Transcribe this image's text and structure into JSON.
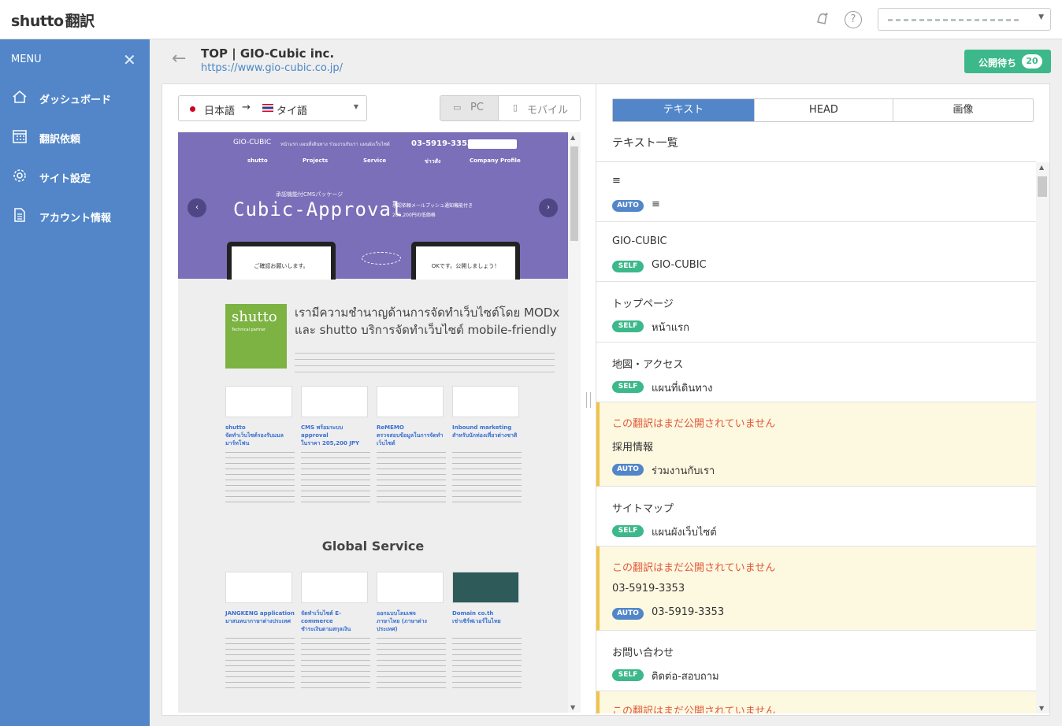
{
  "app": {
    "logo": "shutto",
    "logo_ja": "翻訳",
    "icons": {
      "bell": "notification-bell-icon",
      "help": "?"
    },
    "account_placeholder": ""
  },
  "sidebar": {
    "menu_label": "MENU",
    "close_glyph": "✕",
    "items": [
      {
        "label": "ダッシュボード",
        "icon": "home-icon",
        "glyph": "⌂"
      },
      {
        "label": "翻訳依頼",
        "icon": "calendar-icon",
        "glyph": "▦"
      },
      {
        "label": "サイト設定",
        "icon": "gear-icon",
        "glyph": "⚙"
      },
      {
        "label": "アカウント情報",
        "icon": "document-icon",
        "glyph": "▤"
      }
    ]
  },
  "page": {
    "back_glyph": "←",
    "title": "TOP | GIO-Cubic inc.",
    "url": "https://www.gio-cubic.co.jp/",
    "publish_label": "公開待ち",
    "publish_count": "20"
  },
  "preview": {
    "lang_source": "日本語",
    "lang_arrow": "→",
    "lang_target": "タイ語",
    "device_pc": "PC",
    "device_mobile": "モバイル",
    "site": {
      "brand": "GIO-CUBIC",
      "nav": "หน้าแรก   แผนที่เดินทาง   ร่วมงานกับเรา   แผนผังเว็บไซต์",
      "tel": "03-5919-3353",
      "subnav": [
        "shutto",
        "Projects",
        "Service",
        "ข่าวสัง",
        "Company Profile"
      ],
      "tagline": "承認機能付CMSパッケージ",
      "hero_title": "Cubic-Approval",
      "hero_side": "承認依頼メールプッシュ通知機能付き\n205,200円の低価格",
      "screen_left": "ご確認お願いします。",
      "screen_right": "OKです。公開しましょう！",
      "logo_word": "shutto",
      "logo_sub": "Technical partner",
      "heading": "เรามีความชำนาญด้านการจัดทำเว็บไซต์โดย MODx และ shutto บริการจัดทำเว็บไซต์ mobile-friendly",
      "cards": [
        {
          "title": "shutto\nจัดทำเว็บไซต์รองรับมมล มาร์ทโฟน"
        },
        {
          "title": "CMS พร้อมระบบ approval\nในราคา 205,200 JPY"
        },
        {
          "title": "ReMEMO\nตรวจสอบข้อมูลในการจัดทำเว็บไซต์"
        },
        {
          "title": "Inbound marketing\nสำหรับนักท่องเที่ยวต่างชาติ"
        }
      ],
      "global_service": "Global Service",
      "cards2": [
        {
          "title": "JANGKENG application\nมาสนหนากาษาต่างประเทศ"
        },
        {
          "title": "จัดทำเว็บไซต์ E-commerce\nชำระเงินตามสกุลเงิน"
        },
        {
          "title": "ออกแบบโลมเพจ\nภาษาไทย (ภาษาต่างประเทศ)"
        },
        {
          "title": "Domain co.th\nเช่าเซิร์ฟเวอร์ในไทย"
        }
      ]
    }
  },
  "tabs": [
    {
      "label": "テキスト",
      "active": true
    },
    {
      "label": "HEAD",
      "active": false
    },
    {
      "label": "画像",
      "active": false
    }
  ],
  "list_title": "テキスト一覧",
  "items": [
    {
      "warn": "",
      "source": "≡",
      "badge": "AUTO",
      "translation": "≡"
    },
    {
      "warn": "",
      "source": "GIO-CUBIC",
      "badge": "SELF",
      "translation": "GIO-CUBIC"
    },
    {
      "warn": "",
      "source": "トップページ",
      "badge": "SELF",
      "translation": "หน้าแรก"
    },
    {
      "warn": "",
      "source": "地図・アクセス",
      "badge": "SELF",
      "translation": "แผนที่เดินทาง"
    },
    {
      "warn": "この翻訳はまだ公開されていません",
      "source": "採用情報",
      "badge": "AUTO",
      "translation": "ร่วมงานกับเรา"
    },
    {
      "warn": "",
      "source": "サイトマップ",
      "badge": "SELF",
      "translation": "แผนผังเว็บไซต์"
    },
    {
      "warn": "この翻訳はまだ公開されていません",
      "source": "03-5919-3353",
      "badge": "AUTO",
      "translation": "03-5919-3353"
    },
    {
      "warn": "",
      "source": "お問い合わせ",
      "badge": "SELF",
      "translation": "ติดต่อ-สอบถาม"
    },
    {
      "warn": "この翻訳はまだ公開されていません",
      "source": "",
      "badge": "",
      "translation": ""
    }
  ]
}
